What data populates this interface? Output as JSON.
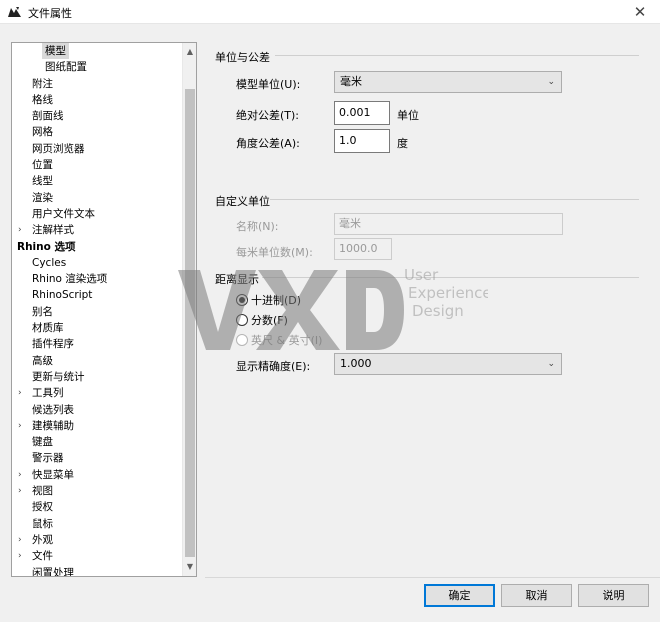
{
  "window": {
    "title": "文件属性",
    "close_glyph": "✕",
    "app_icon": "rhino-app-icon"
  },
  "tree": {
    "items": [
      {
        "label": "模型",
        "indent": 2,
        "selected": true
      },
      {
        "label": "图纸配置",
        "indent": 2
      },
      {
        "label": "附注",
        "indent": 1
      },
      {
        "label": "格线",
        "indent": 1
      },
      {
        "label": "剖面线",
        "indent": 1
      },
      {
        "label": "网格",
        "indent": 1
      },
      {
        "label": "网页浏览器",
        "indent": 1
      },
      {
        "label": "位置",
        "indent": 1
      },
      {
        "label": "线型",
        "indent": 1
      },
      {
        "label": "渲染",
        "indent": 1
      },
      {
        "label": "用户文件文本",
        "indent": 1
      },
      {
        "label": "注解样式",
        "indent": 1,
        "expandable": true
      },
      {
        "label": "Rhino 选项",
        "indent": 0,
        "bold": true
      },
      {
        "label": "Cycles",
        "indent": 1
      },
      {
        "label": "Rhino 渲染选项",
        "indent": 1
      },
      {
        "label": "RhinoScript",
        "indent": 1
      },
      {
        "label": "别名",
        "indent": 1
      },
      {
        "label": "材质库",
        "indent": 1
      },
      {
        "label": "插件程序",
        "indent": 1
      },
      {
        "label": "高级",
        "indent": 1
      },
      {
        "label": "更新与统计",
        "indent": 1
      },
      {
        "label": "工具列",
        "indent": 1,
        "expandable": true
      },
      {
        "label": "候选列表",
        "indent": 1
      },
      {
        "label": "建模辅助",
        "indent": 1,
        "expandable": true
      },
      {
        "label": "键盘",
        "indent": 1
      },
      {
        "label": "警示器",
        "indent": 1
      },
      {
        "label": "快显菜单",
        "indent": 1,
        "expandable": true
      },
      {
        "label": "视图",
        "indent": 1,
        "expandable": true
      },
      {
        "label": "授权",
        "indent": 1
      },
      {
        "label": "鼠标",
        "indent": 1
      },
      {
        "label": "外观",
        "indent": 1,
        "expandable": true
      },
      {
        "label": "文件",
        "indent": 1,
        "expandable": true
      },
      {
        "label": "闲置处理",
        "indent": 1
      }
    ],
    "expand_glyph": "›",
    "scroll_up": "▲",
    "scroll_down": "▼"
  },
  "units": {
    "group_title": "单位与公差",
    "model_units_label": "模型单位(U):",
    "model_units_value": "毫米",
    "abs_tol_label": "绝对公差(T):",
    "abs_tol_value": "0.001",
    "abs_tol_unit": "单位",
    "angle_tol_label": "角度公差(A):",
    "angle_tol_value": "1.0",
    "angle_tol_unit": "度",
    "caret": "⌄"
  },
  "custom_units": {
    "group_title": "自定义单位",
    "name_label": "名称(N):",
    "name_value": "毫米",
    "per_meter_label": "每米单位数(M):",
    "per_meter_value": "1000.0"
  },
  "distance_display": {
    "group_title": "距离显示",
    "options": [
      {
        "label": "十进制(D)",
        "checked": true,
        "disabled": false
      },
      {
        "label": "分数(F)",
        "checked": false,
        "disabled": false
      },
      {
        "label": "英尺 & 英寸(I)",
        "checked": false,
        "disabled": true
      }
    ],
    "precision_label": "显示精确度(E):",
    "precision_value": "1.000"
  },
  "buttons": {
    "ok": "确定",
    "cancel": "取消",
    "help": "说明"
  },
  "watermark": {
    "line1": "User",
    "line2": "Experience",
    "line3": "Design"
  }
}
